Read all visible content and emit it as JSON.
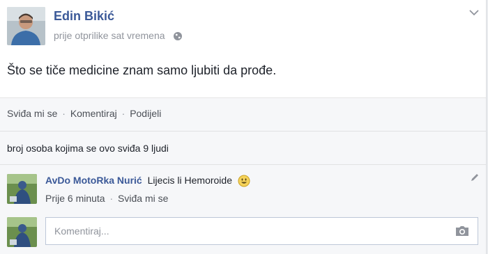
{
  "post": {
    "author": "Edin Bikić",
    "timestamp": "prije otprilike sat vremena",
    "privacy_icon": "globe-icon",
    "menu_icon": "chevron-down-icon",
    "text": "Što se tiče medicine znam samo ljubiti da prođe."
  },
  "actions": {
    "like": "Sviđa mi se",
    "comment": "Komentiraj",
    "share": "Podijeli",
    "separator": "·"
  },
  "likes_summary": "broj osoba kojima se ovo sviđa 9 ljudi",
  "comments": [
    {
      "author": "AvDo MotoRka Nurić",
      "text": "Lijecis li Hemoroide",
      "emoji_icon": "smiley-icon",
      "time": "Prije 6 minuta",
      "like": "Sviđa mi se",
      "edit_icon": "pencil-icon"
    }
  ],
  "comment_input": {
    "placeholder": "Komentiraj...",
    "value": "",
    "attach_icon": "camera-icon"
  },
  "colors": {
    "name_link": "#3b5998",
    "secondary_text": "#90949c",
    "background": "#f6f7f9"
  }
}
